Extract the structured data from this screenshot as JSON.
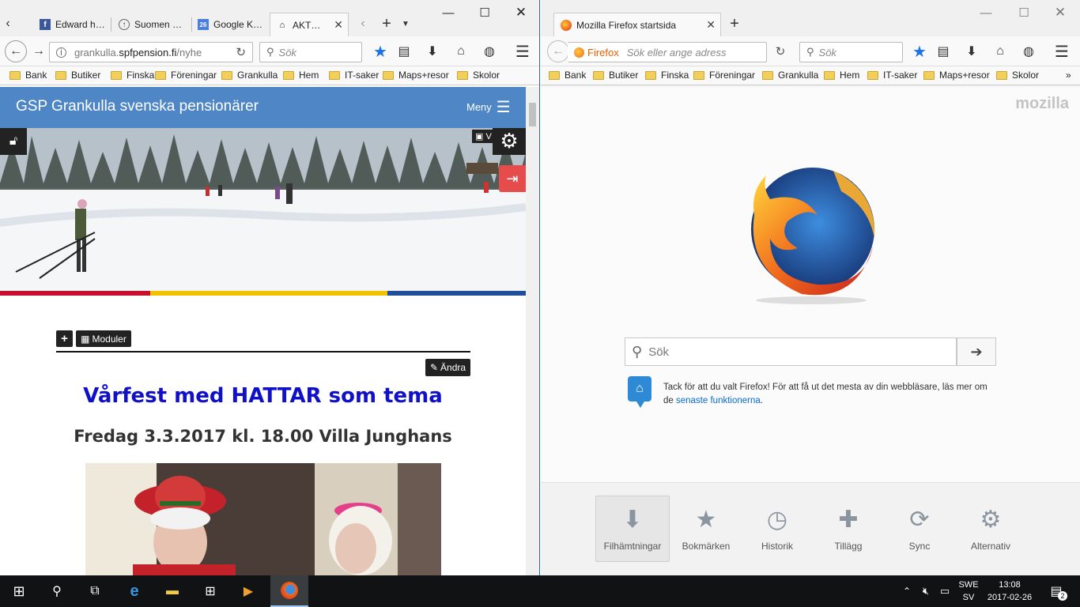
{
  "left_window": {
    "tabs": [
      {
        "label": "Edward h…",
        "icon": "facebook-icon"
      },
      {
        "label": "Suomen …",
        "icon": "globe-icon"
      },
      {
        "label": "Google K…",
        "icon": "calendar-icon",
        "badge": "26"
      },
      {
        "label": "AKT…",
        "icon": "home-icon",
        "active": true
      }
    ],
    "url_plain": "grankulla.",
    "url_domain": "spfpension.fi",
    "url_path": "/nyhe",
    "search_placeholder": "Sök",
    "bookmarks": [
      "Bank",
      "Butiker",
      "Finska",
      "Föreningar",
      "Grankulla",
      "Hem",
      "IT-saker",
      "Maps+resor",
      "Skolor"
    ],
    "site": {
      "title": "GSP Grankulla svenska pensionärer",
      "menu_label": "Meny",
      "hero_button_label": "V",
      "add_label": "+",
      "modules_label": "Moduler",
      "edit_label": "Ändra",
      "headline": "Vårfest med HATTAR som tema",
      "subheadline": "Fredag 3.3.2017 kl. 18.00 Villa Junghans"
    }
  },
  "right_window": {
    "tab": {
      "label": "Mozilla Firefox startsida",
      "icon": "firefox-icon"
    },
    "identity_label": "Firefox",
    "url_placeholder": "Sök eller ange adress",
    "search_placeholder": "Sök",
    "bookmarks": [
      "Bank",
      "Butiker",
      "Finska",
      "Föreningar",
      "Grankulla",
      "Hem",
      "IT-saker",
      "Maps+resor",
      "Skolor"
    ],
    "brand": "mozilla",
    "start_search_placeholder": "Sök",
    "snippet_text": "Tack för att du valt Firefox! För att få ut det mesta av din webbläsare, läs mer om de ",
    "snippet_link": "senaste funktionerna",
    "snippet_end": ".",
    "launcher": [
      {
        "label": "Filhämtningar",
        "icon": "download-icon"
      },
      {
        "label": "Bokmärken",
        "icon": "star-icon"
      },
      {
        "label": "Historik",
        "icon": "clock-icon"
      },
      {
        "label": "Tillägg",
        "icon": "puzzle-icon"
      },
      {
        "label": "Sync",
        "icon": "sync-icon"
      },
      {
        "label": "Alternativ",
        "icon": "gear-icon"
      }
    ]
  },
  "taskbar": {
    "lang_top": "SWE",
    "lang_bottom": "SV",
    "time": "13:08",
    "date": "2017-02-26",
    "notifications": "2"
  },
  "colors": {
    "site_header": "#4f87c6",
    "headline": "#1010c8",
    "star": "#1b73e8",
    "taskbar": "#101214"
  }
}
